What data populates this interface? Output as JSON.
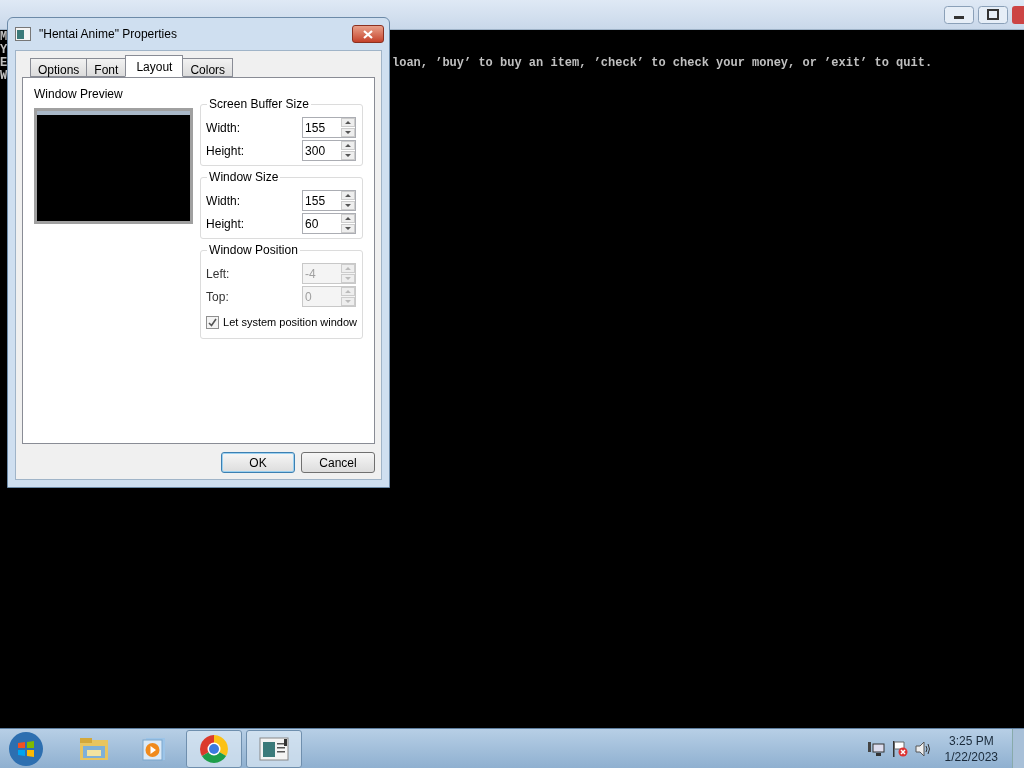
{
  "console": {
    "lines": [
      {
        "start": "M"
      },
      {
        "start": "Y"
      },
      {
        "start": "E",
        "end": "loan, ’buy’ to buy an item, ’check’ to check your money, or ’exit’ to quit."
      },
      {
        "start": "W"
      }
    ]
  },
  "dialog": {
    "title": "\"Hentai Anime\" Properties",
    "tabs": [
      {
        "label": "Options",
        "selected": false
      },
      {
        "label": "Font",
        "selected": false
      },
      {
        "label": "Layout",
        "selected": true
      },
      {
        "label": "Colors",
        "selected": false
      }
    ],
    "preview_label": "Window Preview",
    "groups": [
      {
        "title": "Screen Buffer Size",
        "fields": [
          {
            "label": "Width:",
            "value": "155",
            "disabled": false
          },
          {
            "label": "Height:",
            "value": "300",
            "disabled": false
          }
        ]
      },
      {
        "title": "Window Size",
        "fields": [
          {
            "label": "Width:",
            "value": "155",
            "disabled": false
          },
          {
            "label": "Height:",
            "value": "60",
            "disabled": false
          }
        ]
      },
      {
        "title": "Window Position",
        "fields": [
          {
            "label": "Left:",
            "value": "-4",
            "disabled": true
          },
          {
            "label": "Top:",
            "value": "0",
            "disabled": true
          }
        ],
        "checkbox": {
          "label": "Let system position window",
          "checked": true
        }
      }
    ],
    "buttons": [
      {
        "label": "OK",
        "default": true
      },
      {
        "label": "Cancel",
        "default": false
      }
    ]
  },
  "taskbar": {
    "items": [
      {
        "kind": "folder",
        "open": false
      },
      {
        "kind": "media",
        "open": false
      },
      {
        "kind": "chrome",
        "open": true
      },
      {
        "kind": "console",
        "open": true
      }
    ],
    "clock": {
      "time": "3:25 PM",
      "date": "1/22/2023"
    }
  }
}
